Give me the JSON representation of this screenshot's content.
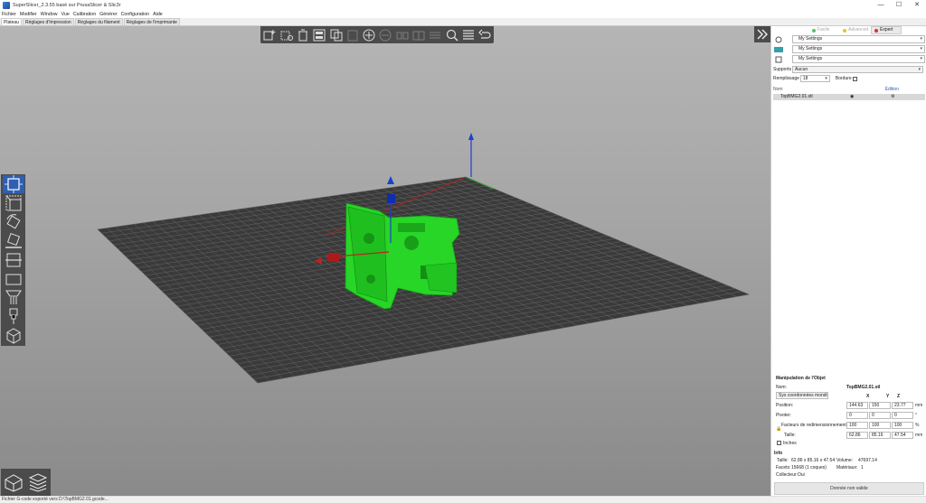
{
  "window": {
    "title": "SuperSlicer_2.3.55 basé sur PrusaSlicer & Slic3r",
    "minimize": "—",
    "maximize": "☐",
    "close": "✕"
  },
  "menu": [
    "Fichier",
    "Modifier",
    "Window",
    "Vue",
    "Calibration",
    "Générer",
    "Configuration",
    "Aide"
  ],
  "tabs": [
    {
      "label": "Plateau",
      "active": true
    },
    {
      "label": "Réglages d'Impression",
      "active": false
    },
    {
      "label": "Réglages du filament",
      "active": false
    },
    {
      "label": "Réglages de l'imprimante",
      "active": false
    }
  ],
  "modes": [
    {
      "label": "Facile",
      "color": "#5ec05e",
      "active": false
    },
    {
      "label": "Advanced",
      "color": "#f0c020",
      "active": false
    },
    {
      "label": "Expert",
      "color": "#e03030",
      "active": true
    }
  ],
  "presets": {
    "print": "My Settings",
    "filament": "My Settings",
    "printer": "My Settings",
    "filament_color": "#34a0a8"
  },
  "settings": {
    "supports_label": "Supports",
    "supports_value": "Aucun",
    "infill_label": "Remplissage",
    "infill_value": "18",
    "brim_label": "Bordure"
  },
  "object_list": {
    "name_header": "Nom",
    "edit_header": "Édition",
    "objects": [
      {
        "name": "TopBMG2.01.stl"
      }
    ]
  },
  "manipulation": {
    "title": "Manipulation de l'Objet",
    "name_label": "Nom:",
    "name_value": "TopBMG2.01.stl",
    "coords": "Sys coordonnées mondi",
    "axes": [
      "X",
      "Y",
      "Z"
    ],
    "position_label": "Position:",
    "position": [
      "144.63",
      "150",
      "23.77"
    ],
    "position_unit": "mm",
    "rotation_label": "Pivoter:",
    "rotation": [
      "0",
      "0",
      "0"
    ],
    "rotation_unit": "°",
    "scale_label": "Facteurs de redimensionnement:",
    "scale": [
      "100",
      "100",
      "100"
    ],
    "scale_unit": "%",
    "size_label": "Taille:",
    "size": [
      "62.86",
      "85.16",
      "47.54"
    ],
    "size_unit": "mm",
    "inches_label": "Inches"
  },
  "info": {
    "title": "Info",
    "size_label": "Taille:",
    "size_value": "62.86 x 85.16 x 47.54",
    "volume_label": "Volume:",
    "volume_value": "47697.14",
    "facets_label": "Facets:",
    "facets_value": "15668 (1 coques)",
    "materials_label": "Matériaux:",
    "materials_value": "1",
    "manifold_label": "Collecteur:",
    "manifold_value": "Oui"
  },
  "export_button": "Donnée non valide",
  "status": "Fichier G-code exporté vers D:\\TopBMG2.01.gcode..."
}
